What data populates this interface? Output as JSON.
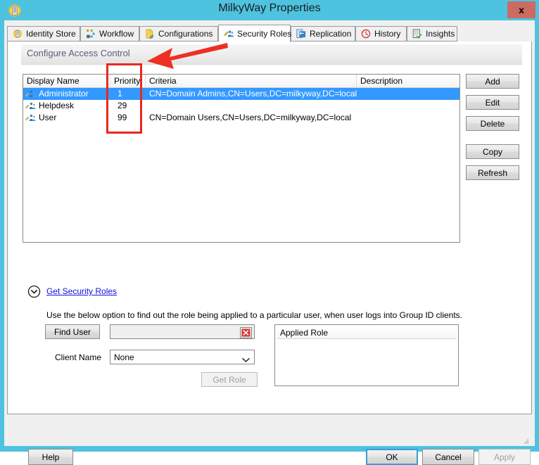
{
  "window": {
    "title": "MilkyWay Properties",
    "icon": "server-identity-icon",
    "close_label": "x",
    "titlebar_color": "#4ec3e0",
    "close_button_color": "#cb6b62"
  },
  "tabs": [
    {
      "label": "Identity Store",
      "icon": "identity-store-icon",
      "active": false
    },
    {
      "label": "Workflow",
      "icon": "workflow-icon",
      "active": false
    },
    {
      "label": "Configurations",
      "icon": "configurations-icon",
      "active": false
    },
    {
      "label": "Security Roles",
      "icon": "security-roles-icon",
      "active": true
    },
    {
      "label": "Replication",
      "icon": "replication-icon",
      "active": false
    },
    {
      "label": "History",
      "icon": "history-icon",
      "active": false
    },
    {
      "label": "Insights",
      "icon": "insights-icon",
      "active": false
    }
  ],
  "section": {
    "title": "Configure Access Control"
  },
  "listview": {
    "columns": [
      "Display Name",
      "Priority",
      "Criteria",
      "Description"
    ],
    "rows": [
      {
        "display_name": "Administrator",
        "priority": "1",
        "criteria": "CN=Domain Admins,CN=Users,DC=milkyway,DC=local",
        "description": "",
        "selected": true,
        "icon": "security-role-icon"
      },
      {
        "display_name": "Helpdesk",
        "priority": "29",
        "criteria": "",
        "description": "",
        "selected": false,
        "icon": "security-role-icon"
      },
      {
        "display_name": "User",
        "priority": "99",
        "criteria": "CN=Domain Users,CN=Users,DC=milkyway,DC=local",
        "description": "",
        "selected": false,
        "icon": "security-role-icon"
      }
    ]
  },
  "side_buttons": [
    {
      "label": "Add",
      "enabled": true
    },
    {
      "label": "Edit",
      "enabled": true
    },
    {
      "label": "Delete",
      "enabled": true
    },
    {
      "label": "Copy",
      "enabled": true
    },
    {
      "label": "Refresh",
      "enabled": true
    }
  ],
  "get_security_roles": {
    "link_label": "Get Security Roles",
    "link_color": "#1111dd",
    "expander_icon": "chevron-down-circle-icon",
    "description": "Use the below option to find out the role being applied to a particular user, when user logs into Group ID clients.",
    "find_user_label": "Find User",
    "user_value": "",
    "user_placeholder": "",
    "clear_icon": "clear-red-x-icon",
    "client_name_label": "Client Name",
    "client_name_value": "None",
    "client_name_options": [
      "None"
    ],
    "get_role_label": "Get Role",
    "get_role_enabled": false,
    "applied_role_header": "Applied Role",
    "applied_role_rows": []
  },
  "footer": {
    "help_label": "Help",
    "ok_label": "OK",
    "cancel_label": "Cancel",
    "apply_label": "Apply",
    "apply_enabled": false
  },
  "annotations": {
    "highlight_color": "#e8291e",
    "rectangle_target": "Priority",
    "arrow_points_to": "Priority column"
  }
}
